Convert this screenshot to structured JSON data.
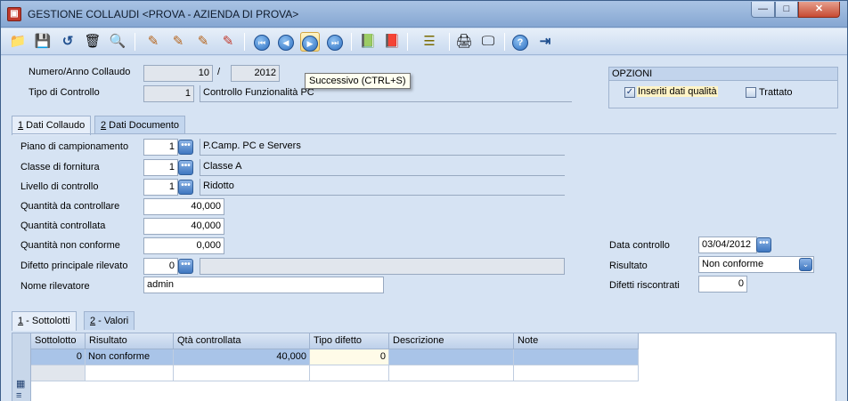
{
  "window": {
    "title": "GESTIONE COLLAUDI <PROVA - AZIENDA DI PROVA>",
    "min_glyph": "—",
    "max_glyph": "□",
    "close_glyph": "✕"
  },
  "toolbar": {
    "icons": {
      "new": "📁",
      "save": "💾",
      "undo": "↺",
      "delete": "🗑",
      "search": "🔍",
      "edit1": "✎",
      "edit2": "✎",
      "edit3": "✎",
      "edit4": "✎",
      "first": "⏮",
      "prev": "◀",
      "next": "▶",
      "last": "⏭",
      "book_green": "📗",
      "book_red": "📕",
      "list": "☰",
      "print": "🖨",
      "screen": "🖵",
      "help": "?",
      "exit": "⇥"
    },
    "tooltip": "Successivo (CTRL+S)"
  },
  "header": {
    "numero_label": "Numero/Anno Collaudo",
    "numero_value": "10",
    "slash": "/",
    "anno_value": "2012",
    "tipo_label": "Tipo di Controllo",
    "tipo_code": "1",
    "tipo_desc": "Controllo Funzionalità PC"
  },
  "options": {
    "title": "OPZIONI",
    "inseriti_label": "Inseriti dati qualità",
    "inseriti_checked": "✓",
    "trattato_label": "Trattato"
  },
  "tabs_top": [
    {
      "key": "1",
      "label": " Dati Collaudo"
    },
    {
      "key": "2",
      "label": " Dati Documento"
    }
  ],
  "collaudo": {
    "piano_label": "Piano di campionamento",
    "piano_code": "1",
    "piano_desc": "P.Camp. PC e Servers",
    "classe_label": "Classe di fornitura",
    "classe_code": "1",
    "classe_desc": "Classe A",
    "livello_label": "Livello di controllo",
    "livello_code": "1",
    "livello_desc": "Ridotto",
    "qta_da_label": "Quantità da controllare",
    "qta_da_value": "40,000",
    "qta_contr_label": "Quantità controllata",
    "qta_contr_value": "40,000",
    "qta_non_label": "Quantità non conforme",
    "qta_non_value": "0,000",
    "difetto_label": "Difetto principale rilevato",
    "difetto_code": "0",
    "difetto_desc": "",
    "nome_label": "Nome rilevatore",
    "nome_value": "admin",
    "data_label": "Data controllo",
    "data_value": "03/04/2012",
    "risultato_label": "Risultato",
    "risultato_value": "Non conforme",
    "difetti_label": "Difetti riscontrati",
    "difetti_value": "0",
    "dots": "•••",
    "chevron": "⌄"
  },
  "tabs_bottom": [
    {
      "key": "1",
      "label": " - Sottolotti"
    },
    {
      "key": "2",
      "label": " - Valori"
    }
  ],
  "grid": {
    "columns": [
      "Sottolotto",
      "Risultato",
      "Qtà controllata",
      "Tipo difetto",
      "Descrizione",
      "Note"
    ],
    "rows": [
      [
        "0",
        "Non conforme",
        "40,000",
        "0",
        "",
        ""
      ]
    ],
    "side_icons": {
      "a": "▦",
      "b": "≡"
    }
  }
}
